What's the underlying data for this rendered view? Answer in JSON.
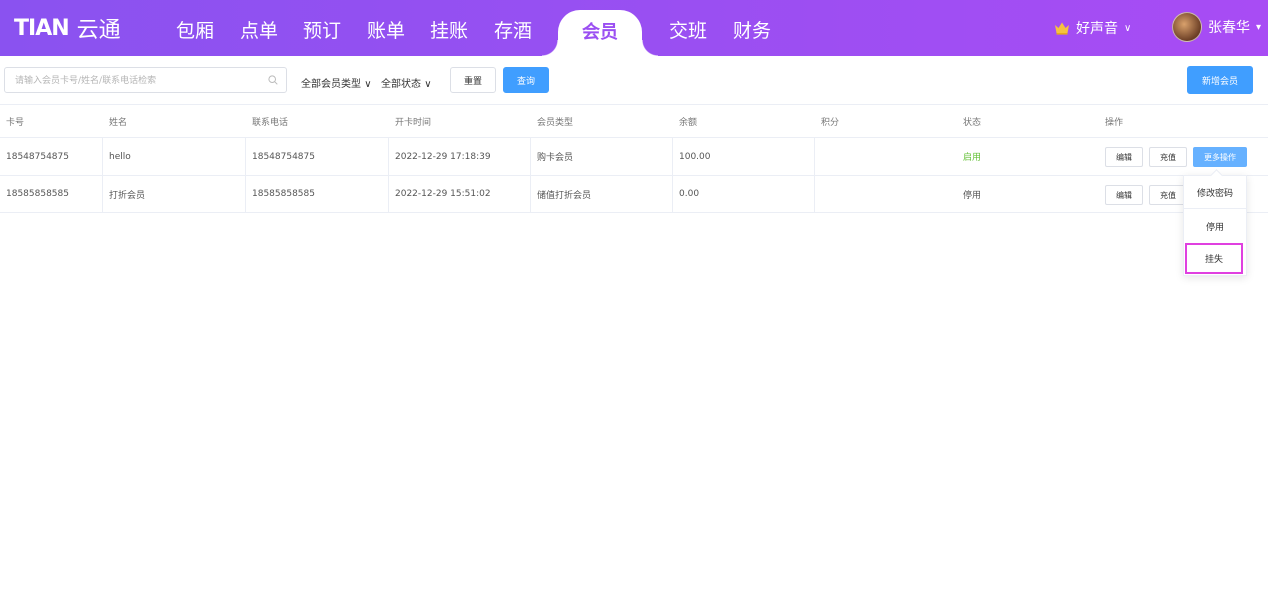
{
  "app": {
    "logo_mark": "TIAN",
    "logo_text": "云通"
  },
  "nav": {
    "items": [
      "包厢",
      "点单",
      "预订",
      "账单",
      "挂账",
      "存酒",
      "会员",
      "交班",
      "财务"
    ],
    "active": "会员"
  },
  "header": {
    "store_name": "好声音",
    "user_name": "张春华"
  },
  "toolbar": {
    "search_placeholder": "请输入会员卡号/姓名/联系电话检索",
    "filter_type": "全部会员类型",
    "filter_status": "全部状态",
    "reset_label": "重置",
    "query_label": "查询",
    "add_label": "新增会员"
  },
  "table": {
    "columns": [
      "卡号",
      "姓名",
      "联系电话",
      "开卡时间",
      "会员类型",
      "余额",
      "积分",
      "状态",
      "操作"
    ],
    "rows": [
      {
        "card": "18548754875",
        "name": "hello",
        "phone": "18548754875",
        "opened": "2022-12-29 17:18:39",
        "type": "购卡会员",
        "balance": "100.00",
        "points": "",
        "status": "启用"
      },
      {
        "card": "18585858585",
        "name": "打折会员",
        "phone": "18585858585",
        "opened": "2022-12-29 15:51:02",
        "type": "储值打折会员",
        "balance": "0.00",
        "points": "",
        "status": "停用"
      }
    ],
    "ops": {
      "edit": "编辑",
      "recharge": "充值",
      "more": "更多操作"
    }
  },
  "dropdown": {
    "items": [
      "修改密码",
      "停用",
      "挂失"
    ]
  },
  "colors": {
    "header_start": "#8a52f0",
    "header_end": "#a84cf4",
    "primary": "#409eff",
    "status_on": "#67c23a",
    "highlight": "#e040e0"
  }
}
